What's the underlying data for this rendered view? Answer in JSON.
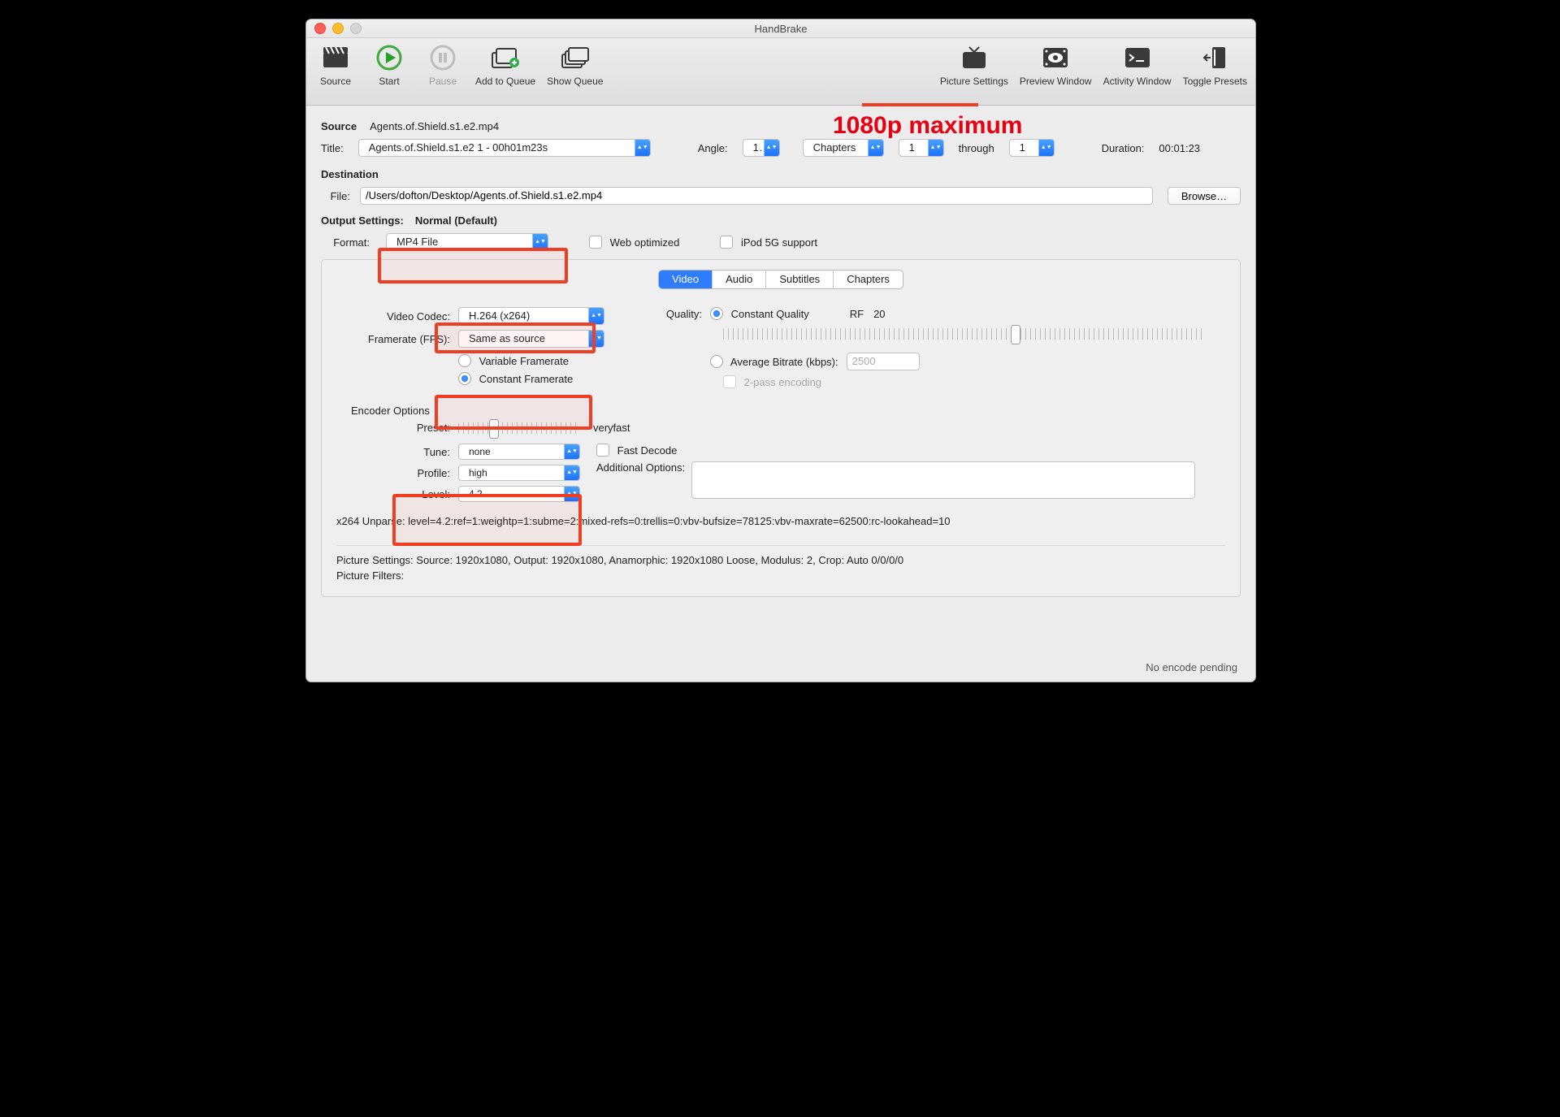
{
  "window": {
    "title": "HandBrake"
  },
  "toolbar_left": {
    "source": "Source",
    "start": "Start",
    "pause": "Pause",
    "add_queue": "Add to Queue",
    "show_queue": "Show Queue"
  },
  "toolbar_right": {
    "picture": "Picture Settings",
    "preview": "Preview Window",
    "activity": "Activity Window",
    "toggle": "Toggle Presets"
  },
  "annotation": {
    "text": "1080p maximum"
  },
  "source": {
    "label": "Source",
    "name": "Agents.of.Shield.s1.e2.mp4",
    "title_label": "Title:",
    "title_value": "Agents.of.Shield.s1.e2 1 - 00h01m23s",
    "angle_label": "Angle:",
    "angle_value": "1",
    "chapters_label": "Chapters",
    "chapters_from": "1",
    "through_label": "through",
    "chapters_to": "1",
    "duration_label": "Duration:",
    "duration_value": "00:01:23"
  },
  "destination": {
    "heading": "Destination",
    "file_label": "File:",
    "file_value": "/Users/dofton/Desktop/Agents.of.Shield.s1.e2.mp4",
    "browse_label": "Browse…"
  },
  "output": {
    "heading": "Output Settings:",
    "preset": "Normal (Default)",
    "format_label": "Format:",
    "format_value": "MP4 File",
    "web_opt_label": "Web optimized",
    "ipod_label": "iPod 5G support"
  },
  "tabs": {
    "video": "Video",
    "audio": "Audio",
    "subtitles": "Subtitles",
    "chapters": "Chapters"
  },
  "video": {
    "codec_label": "Video Codec:",
    "codec_value": "H.264 (x264)",
    "fps_label": "Framerate (FPS):",
    "fps_value": "Same as source",
    "vfr_label": "Variable Framerate",
    "cfr_label": "Constant Framerate",
    "quality_label": "Quality:",
    "cq_label": "Constant Quality",
    "rf_label": "RF",
    "rf_value": "20",
    "abr_label": "Average Bitrate (kbps):",
    "abr_value": "2500",
    "twopass_label": "2-pass encoding"
  },
  "encoder": {
    "heading": "Encoder Options",
    "preset_label": "Preset:",
    "preset_value": "veryfast",
    "tune_label": "Tune:",
    "tune_value": "none",
    "fastdecode_label": "Fast Decode",
    "profile_label": "Profile:",
    "profile_value": "high",
    "level_label": "Level:",
    "level_value": "4.2",
    "addopts_label": "Additional Options:",
    "addopts_value": ""
  },
  "x264_unparse": "x264 Unparse: level=4.2:ref=1:weightp=1:subme=2:mixed-refs=0:trellis=0:vbv-bufsize=78125:vbv-maxrate=62500:rc-lookahead=10",
  "footer": {
    "picture_settings": "Picture Settings: Source: 1920x1080, Output: 1920x1080, Anamorphic: 1920x1080 Loose, Modulus: 2, Crop: Auto 0/0/0/0",
    "picture_filters": "Picture Filters:"
  },
  "status": "No encode pending"
}
